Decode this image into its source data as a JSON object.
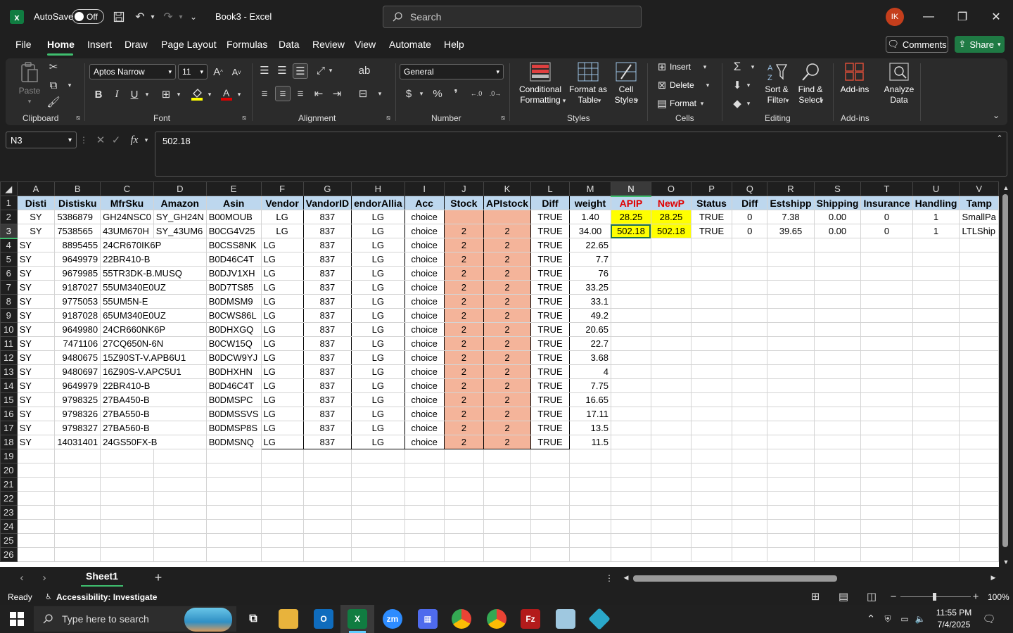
{
  "titlebar": {
    "autosave_label": "AutoSave",
    "autosave_state": "Off",
    "doc_title": "Book3 - Excel",
    "search_placeholder": "Search",
    "user_initials": "IK"
  },
  "menu": [
    "File",
    "Home",
    "Insert",
    "Draw",
    "Page Layout",
    "Formulas",
    "Data",
    "Review",
    "View",
    "Automate",
    "Help"
  ],
  "actions": {
    "comments": "Comments",
    "share": "Share"
  },
  "ribbon": {
    "clipboard": {
      "label": "Clipboard",
      "paste": "Paste"
    },
    "font": {
      "label": "Font",
      "name": "Aptos Narrow",
      "size": "11"
    },
    "alignment": {
      "label": "Alignment"
    },
    "number": {
      "label": "Number",
      "format": "General"
    },
    "styles": {
      "label": "Styles",
      "conditional": "Conditional\nFormatting",
      "format_table": "Format as\nTable",
      "cell_styles": "Cell\nStyles"
    },
    "cells": {
      "label": "Cells",
      "insert": "Insert",
      "delete": "Delete",
      "format": "Format"
    },
    "editing": {
      "label": "Editing",
      "sort": "Sort &\nFilter",
      "find": "Find &\nSelect"
    },
    "addins": {
      "label": "Add-ins",
      "addins_btn": "Add-ins",
      "analyze": "Analyze\nData"
    }
  },
  "formula_bar": {
    "name_box": "N3",
    "formula": "502.18"
  },
  "columns": [
    "A",
    "B",
    "C",
    "D",
    "E",
    "F",
    "G",
    "H",
    "I",
    "J",
    "K",
    "L",
    "M",
    "N",
    "O",
    "P",
    "Q",
    "R",
    "S",
    "T",
    "U",
    "V"
  ],
  "header_row": [
    "Disti",
    "Distisku",
    "MfrSku",
    "Amazon",
    "Asin",
    "Vendor",
    "VandorID",
    "endorAllia",
    "Acc",
    "Stock",
    "APIstock",
    "Diff",
    "weight",
    "APIP",
    "NewP",
    "Status",
    "Diff",
    "Estshipp",
    "Shipping",
    "Insurance",
    "Handling",
    "Tamp"
  ],
  "rows_top": [
    [
      "SY",
      "5386879",
      "GH24NSC0",
      "SY_GH24N",
      "B00MOUB",
      "LG",
      "837",
      "LG",
      "choice",
      "",
      "",
      "TRUE",
      "1.40",
      "28.25",
      "28.25",
      "TRUE",
      "0",
      "7.38",
      "0.00",
      "0",
      "1",
      "SmallPa"
    ],
    [
      "SY",
      "7538565",
      "43UM670H",
      "SY_43UM6",
      "B0CG4V25",
      "LG",
      "837",
      "LG",
      "choice",
      "2",
      "2",
      "TRUE",
      "34.00",
      "502.18",
      "502.18",
      "TRUE",
      "0",
      "39.65",
      "0.00",
      "0",
      "1",
      "LTLShip"
    ]
  ],
  "rows_data": [
    [
      "SY",
      "8895455",
      "24CR670IK6P",
      "B0CSS8NK",
      "LG",
      "837",
      "LG",
      "choice",
      "2",
      "2",
      "TRUE",
      "22.65"
    ],
    [
      "SY",
      "9649979",
      "22BR410-B",
      "B0D46C4T",
      "LG",
      "837",
      "LG",
      "choice",
      "2",
      "2",
      "TRUE",
      "7.7"
    ],
    [
      "SY",
      "9679985",
      "55TR3DK-B.MUSQ",
      "B0DJV1XH",
      "LG",
      "837",
      "LG",
      "choice",
      "2",
      "2",
      "TRUE",
      "76"
    ],
    [
      "SY",
      "9187027",
      "55UM340E0UZ",
      "B0D7TS85",
      "LG",
      "837",
      "LG",
      "choice",
      "2",
      "2",
      "TRUE",
      "33.25"
    ],
    [
      "SY",
      "9775053",
      "55UM5N-E",
      "B0DMSM9",
      "LG",
      "837",
      "LG",
      "choice",
      "2",
      "2",
      "TRUE",
      "33.1"
    ],
    [
      "SY",
      "9187028",
      "65UM340E0UZ",
      "B0CWS86L",
      "LG",
      "837",
      "LG",
      "choice",
      "2",
      "2",
      "TRUE",
      "49.2"
    ],
    [
      "SY",
      "9649980",
      "24CR660NK6P",
      "B0DHXGQ",
      "LG",
      "837",
      "LG",
      "choice",
      "2",
      "2",
      "TRUE",
      "20.65"
    ],
    [
      "SY",
      "7471106",
      "27CQ650N-6N",
      "B0CW15Q",
      "LG",
      "837",
      "LG",
      "choice",
      "2",
      "2",
      "TRUE",
      "22.7"
    ],
    [
      "SY",
      "9480675",
      "15Z90ST-V.APB6U1",
      "B0DCW9YJ",
      "LG",
      "837",
      "LG",
      "choice",
      "2",
      "2",
      "TRUE",
      "3.68"
    ],
    [
      "SY",
      "9480697",
      "16Z90S-V.APC5U1",
      "B0DHXHN",
      "LG",
      "837",
      "LG",
      "choice",
      "2",
      "2",
      "TRUE",
      "4"
    ],
    [
      "SY",
      "9649979",
      "22BR410-B",
      "B0D46C4T",
      "LG",
      "837",
      "LG",
      "choice",
      "2",
      "2",
      "TRUE",
      "7.75"
    ],
    [
      "SY",
      "9798325",
      "27BA450-B",
      "B0DMSPC",
      "LG",
      "837",
      "LG",
      "choice",
      "2",
      "2",
      "TRUE",
      "16.65"
    ],
    [
      "SY",
      "9798326",
      "27BA550-B",
      "B0DMSSVS",
      "LG",
      "837",
      "LG",
      "choice",
      "2",
      "2",
      "TRUE",
      "17.11"
    ],
    [
      "SY",
      "9798327",
      "27BA560-B",
      "B0DMSP8S",
      "LG",
      "837",
      "LG",
      "choice",
      "2",
      "2",
      "TRUE",
      "13.5"
    ],
    [
      "SY",
      "14031401",
      "24GS50FX-B",
      "B0DMSNQ",
      "LG",
      "837",
      "LG",
      "choice",
      "2",
      "2",
      "TRUE",
      "11.5"
    ]
  ],
  "empty_rows": [
    "19",
    "20",
    "21",
    "22",
    "23",
    "24",
    "25",
    "26"
  ],
  "sheet_tab": "Sheet1",
  "status": {
    "ready": "Ready",
    "accessibility": "Accessibility: Investigate",
    "zoom": "100%"
  },
  "taskbar": {
    "search_placeholder": "Type here to search",
    "time": "11:55 PM",
    "date": "7/4/2025"
  }
}
